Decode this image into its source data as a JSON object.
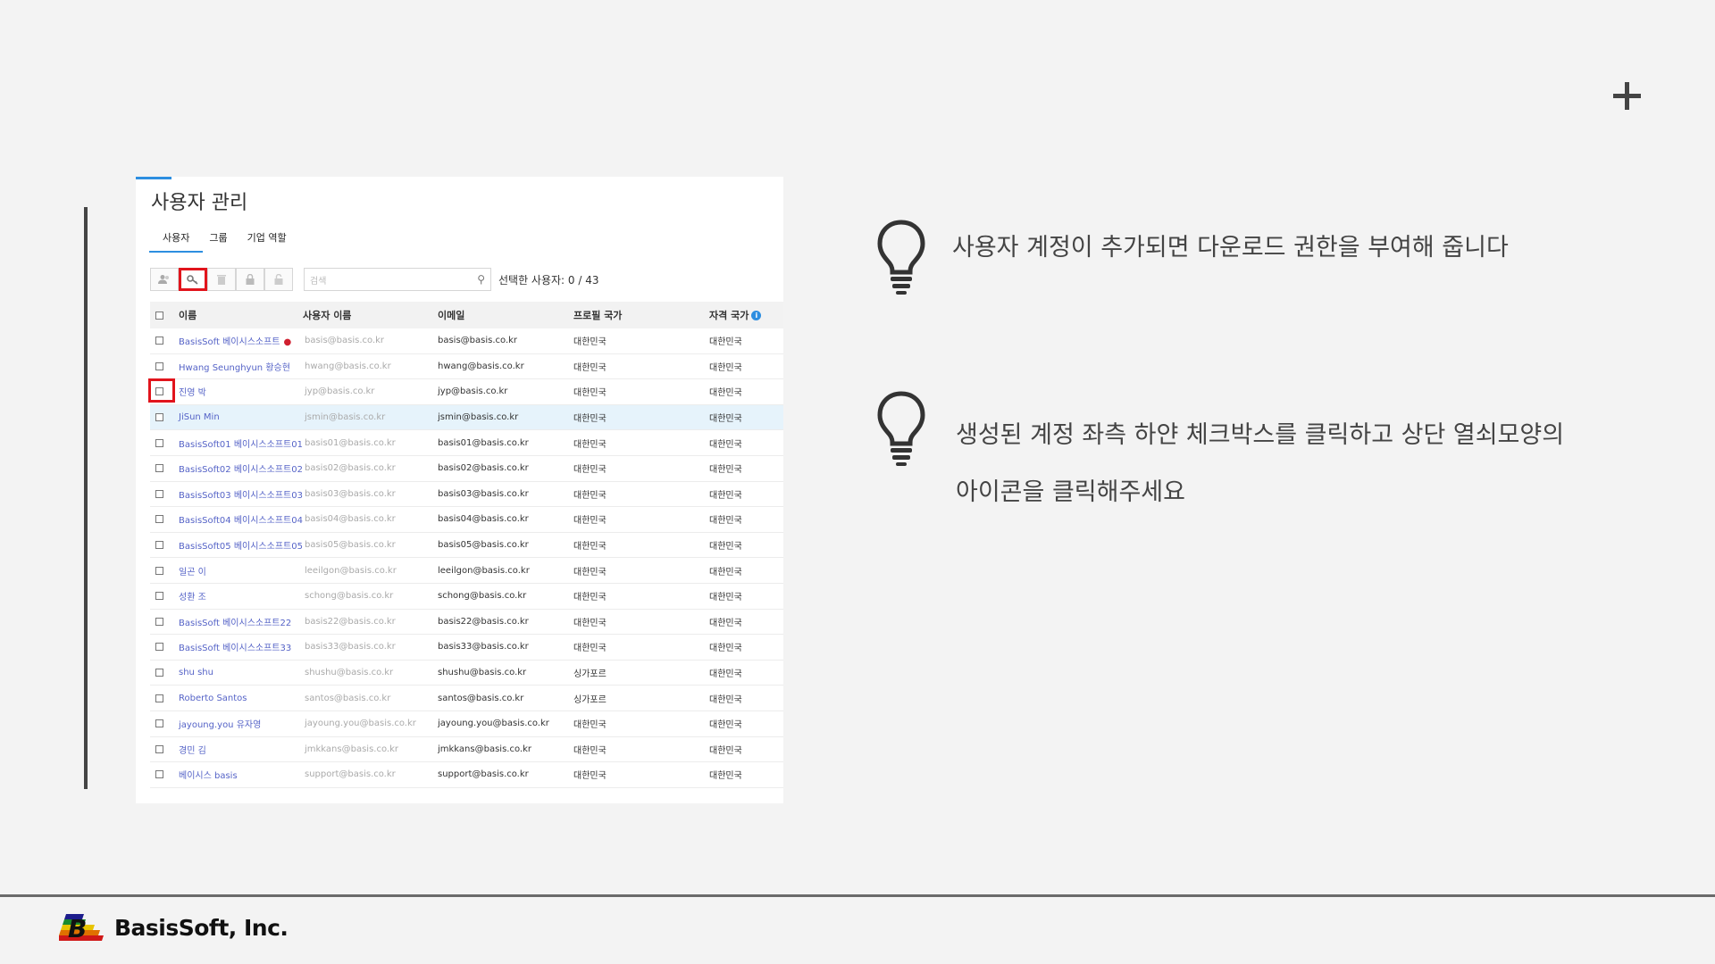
{
  "panel": {
    "title": "사용자 관리",
    "tabs": [
      "사용자",
      "그룹",
      "기업 역할"
    ],
    "search_placeholder": "검색",
    "selected_count": "선택한 사용자: 0 / 43",
    "toolbar_icons": [
      "add-user-icon",
      "key-icon",
      "trash-icon",
      "lock-icon",
      "unlock-icon"
    ]
  },
  "table": {
    "headers": [
      "이름",
      "사용자 이름",
      "이메일",
      "프로필 국가",
      "자격 국가"
    ],
    "rows": [
      {
        "name": "BasisSoft 베이시스소프트",
        "user": "basis@basis.co.kr",
        "email": "basis@basis.co.kr",
        "country": "대한민국",
        "cert": "대한민국"
      },
      {
        "name": "Hwang Seunghyun 황승현",
        "user": "hwang@basis.co.kr",
        "email": "hwang@basis.co.kr",
        "country": "대한민국",
        "cert": "대한민국"
      },
      {
        "name": "진영 박",
        "user": "jyp@basis.co.kr",
        "email": "jyp@basis.co.kr",
        "country": "대한민국",
        "cert": "대한민국"
      },
      {
        "name": "JiSun Min",
        "user": "jsmin@basis.co.kr",
        "email": "jsmin@basis.co.kr",
        "country": "대한민국",
        "cert": "대한민국"
      },
      {
        "name": "BasisSoft01 베이시스소프트01",
        "user": "basis01@basis.co.kr",
        "email": "basis01@basis.co.kr",
        "country": "대한민국",
        "cert": "대한민국"
      },
      {
        "name": "BasisSoft02 베이시스소프트02",
        "user": "basis02@basis.co.kr",
        "email": "basis02@basis.co.kr",
        "country": "대한민국",
        "cert": "대한민국"
      },
      {
        "name": "BasisSoft03 베이시스소프트03",
        "user": "basis03@basis.co.kr",
        "email": "basis03@basis.co.kr",
        "country": "대한민국",
        "cert": "대한민국"
      },
      {
        "name": "BasisSoft04 베이시스소프트04",
        "user": "basis04@basis.co.kr",
        "email": "basis04@basis.co.kr",
        "country": "대한민국",
        "cert": "대한민국"
      },
      {
        "name": "BasisSoft05 베이시스소프트05",
        "user": "basis05@basis.co.kr",
        "email": "basis05@basis.co.kr",
        "country": "대한민국",
        "cert": "대한민국"
      },
      {
        "name": "일곤 이",
        "user": "leeilgon@basis.co.kr",
        "email": "leeilgon@basis.co.kr",
        "country": "대한민국",
        "cert": "대한민국"
      },
      {
        "name": "성환 조",
        "user": "schong@basis.co.kr",
        "email": "schong@basis.co.kr",
        "country": "대한민국",
        "cert": "대한민국"
      },
      {
        "name": "BasisSoft 베이시스소프트22",
        "user": "basis22@basis.co.kr",
        "email": "basis22@basis.co.kr",
        "country": "대한민국",
        "cert": "대한민국"
      },
      {
        "name": "BasisSoft 베이시스소프트33",
        "user": "basis33@basis.co.kr",
        "email": "basis33@basis.co.kr",
        "country": "대한민국",
        "cert": "대한민국"
      },
      {
        "name": "shu shu",
        "user": "shushu@basis.co.kr",
        "email": "shushu@basis.co.kr",
        "country": "싱가포르",
        "cert": "대한민국"
      },
      {
        "name": "Roberto Santos",
        "user": "santos@basis.co.kr",
        "email": "santos@basis.co.kr",
        "country": "싱가포르",
        "cert": "대한민국"
      },
      {
        "name": "jayoung.you 유자영",
        "user": "jayoung.you@basis.co.kr",
        "email": "jayoung.you@basis.co.kr",
        "country": "대한민국",
        "cert": "대한민국"
      },
      {
        "name": "경민 김",
        "user": "jmkkans@basis.co.kr",
        "email": "jmkkans@basis.co.kr",
        "country": "대한민국",
        "cert": "대한민국"
      },
      {
        "name": "베이시스 basis",
        "user": "support@basis.co.kr",
        "email": "support@basis.co.kr",
        "country": "대한민국",
        "cert": "대한민국"
      }
    ]
  },
  "instructions": [
    {
      "lines": [
        "사용자 계정이 추가되면 다운로드 권한을 부여해 줍니다"
      ],
      "icon": "lightbulb-icon"
    },
    {
      "lines": [
        "생성된 계정 좌측 하얀 체크박스를 클릭하고 상단 열쇠모양의",
        "아이콘을 클릭해주세요"
      ],
      "icon": "lightbulb-icon"
    }
  ],
  "footer": {
    "company": "BasisSoft, Inc."
  },
  "colors": {
    "highlight": "#e1141c",
    "accent": "#2d8ee0",
    "link": "#5563c7"
  }
}
